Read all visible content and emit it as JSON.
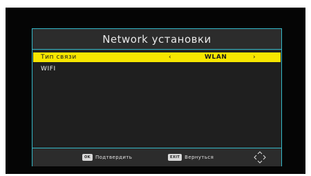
{
  "screen": {
    "title": "Network установки"
  },
  "menu": {
    "items": [
      {
        "label": "Тип связи",
        "value": "WLAN",
        "left_arrow": "‹",
        "right_arrow": "›",
        "selected": true
      },
      {
        "label": "WIFI",
        "value": "",
        "selected": false
      }
    ]
  },
  "footer": {
    "ok_key": "OK",
    "ok_label": "Подтвердить",
    "exit_key": "EXIT",
    "exit_label": "Вернуться",
    "nav_icon": "dpad-arrows-icon"
  },
  "colors": {
    "accent_border": "#35b8c8",
    "selection": "#f7e600",
    "panel_bg": "#2a2a2a"
  }
}
